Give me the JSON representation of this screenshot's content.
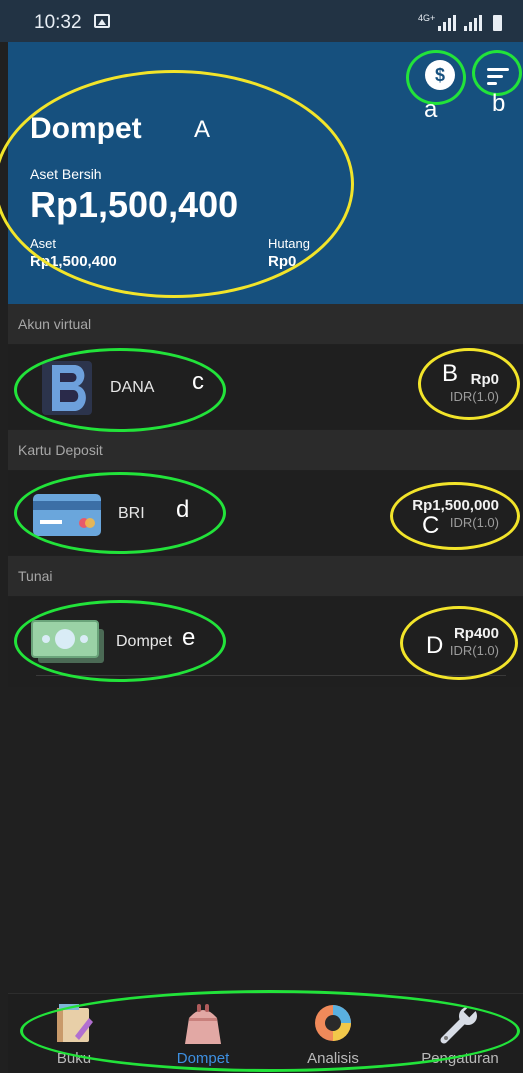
{
  "status_bar": {
    "time": "10:32",
    "network": "4G+"
  },
  "header": {
    "title": "Dompet",
    "net_assets_label": "Aset Bersih",
    "net_assets_value": "Rp1,500,400",
    "assets_label": "Aset",
    "assets_value": "Rp1,500,400",
    "debt_label": "Hutang",
    "debt_value": "Rp0",
    "currency_icon": "$"
  },
  "sections": [
    {
      "label": "Akun virtual",
      "account": {
        "name": "DANA",
        "amount": "Rp0",
        "currency": "IDR(1.0)"
      }
    },
    {
      "label": "Kartu Deposit",
      "account": {
        "name": "BRI",
        "amount": "Rp1,500,000",
        "currency": "IDR(1.0)"
      }
    },
    {
      "label": "Tunai",
      "account": {
        "name": "Dompet",
        "amount": "Rp400",
        "currency": "IDR(1.0)"
      }
    }
  ],
  "bottom_nav": [
    {
      "label": "Buku",
      "icon": "book-icon",
      "active": false
    },
    {
      "label": "Dompet",
      "icon": "purse-icon",
      "active": true
    },
    {
      "label": "Analisis",
      "icon": "pie-chart-icon",
      "active": false
    },
    {
      "label": "Pengaturan",
      "icon": "wrench-icon",
      "active": false
    }
  ],
  "annotations": {
    "a": "a",
    "b": "b",
    "A": "A",
    "B": "B",
    "C": "C",
    "D": "D",
    "c": "c",
    "d": "d",
    "e": "e"
  },
  "colors": {
    "header_bg": "#16507e",
    "active_nav": "#3d8fe0",
    "annotation_green": "#22e33a",
    "annotation_yellow": "#f2e42a"
  }
}
